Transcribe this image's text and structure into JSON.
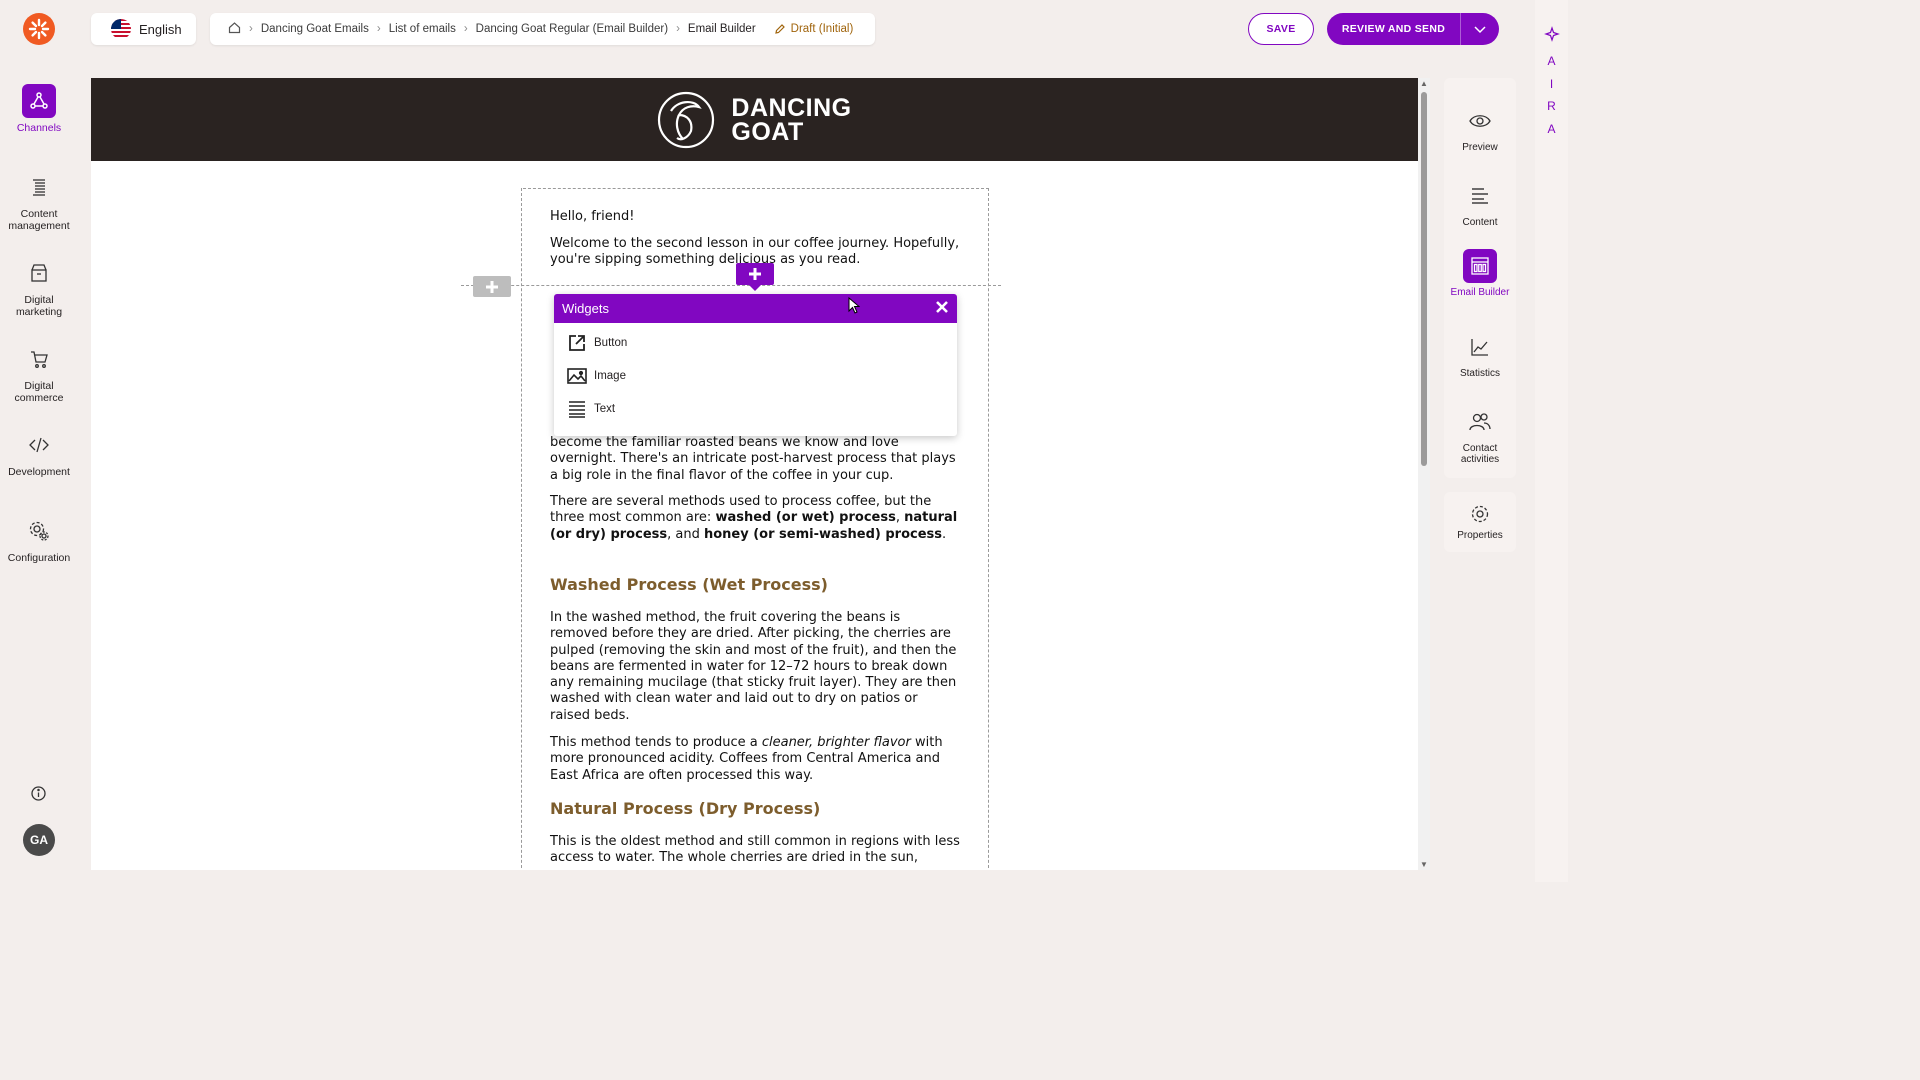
{
  "nav": {
    "items": [
      {
        "label": "Channels",
        "icon": "channels-icon"
      },
      {
        "label": "Content management",
        "icon": "content-management-icon"
      },
      {
        "label": "Digital marketing",
        "icon": "digital-marketing-icon"
      },
      {
        "label": "Digital commerce",
        "icon": "digital-commerce-icon"
      },
      {
        "label": "Development",
        "icon": "development-icon"
      },
      {
        "label": "Configuration",
        "icon": "configuration-icon"
      }
    ],
    "avatar": "GA"
  },
  "header": {
    "language": "English",
    "breadcrumbs": [
      "Dancing Goat Emails",
      "List of emails",
      "Dancing Goat Regular (Email Builder)",
      "Email Builder"
    ],
    "status": "Draft (Initial)",
    "save_label": "SAVE",
    "review_label": "REVIEW AND SEND"
  },
  "aira": [
    "A",
    "I",
    "R",
    "A"
  ],
  "email": {
    "brand_line1": "DANCING",
    "brand_line2": "GOAT",
    "greeting": "Hello, friend!",
    "intro": "Welcome to the second lesson in our coffee journey. Hopefully, you're sipping something delicious as you read.",
    "para_hidden_tail": "become the familiar roasted beans we know and love overnight. There's an intricate post-harvest process that plays a big role in the final flavor of the coffee in your cup.",
    "methods_a": "There are several methods used to process coffee, but the three most common are: ",
    "methods_b1": "washed (or wet) process",
    "methods_b2": "natural (or dry) process",
    "methods_b3": "honey (or semi-washed) process",
    "washed_heading": "Washed Process (Wet Process)",
    "washed_text": "In the washed method, the fruit covering the beans is removed before they are dried. After picking, the cherries are pulped (removing the skin and most of the fruit), and then the beans are fermented in water for 12–72 hours to break down any remaining mucilage (that sticky fruit layer). They are then washed with clean water and laid out to dry on patios or raised beds.",
    "washed_flavor_a": "This method tends to produce a ",
    "washed_flavor_em": "cleaner, brighter flavor",
    "washed_flavor_b": " with more pronounced acidity. Coffees from Central America and East Africa are often processed this way.",
    "natural_heading": "Natural Process (Dry Process)",
    "natural_text": "This is the oldest method and still common in regions with less access to water. The whole cherries are dried in the sun,"
  },
  "widgets": {
    "title": "Widgets",
    "items": [
      "Button",
      "Image",
      "Text"
    ]
  },
  "right_panel": {
    "items": [
      {
        "label": "Preview",
        "icon": "eye-icon"
      },
      {
        "label": "Content",
        "icon": "content-icon"
      },
      {
        "label": "Email Builder",
        "icon": "email-builder-icon"
      },
      {
        "label": "Statistics",
        "icon": "statistics-icon"
      },
      {
        "label": "Contact activities",
        "icon": "contact-activities-icon"
      }
    ],
    "properties": "Properties"
  },
  "colors": {
    "accent": "#8107c1",
    "brand_orange": "#f05a22",
    "heading_brown": "#7d5d2d",
    "draft": "#a0640c"
  }
}
